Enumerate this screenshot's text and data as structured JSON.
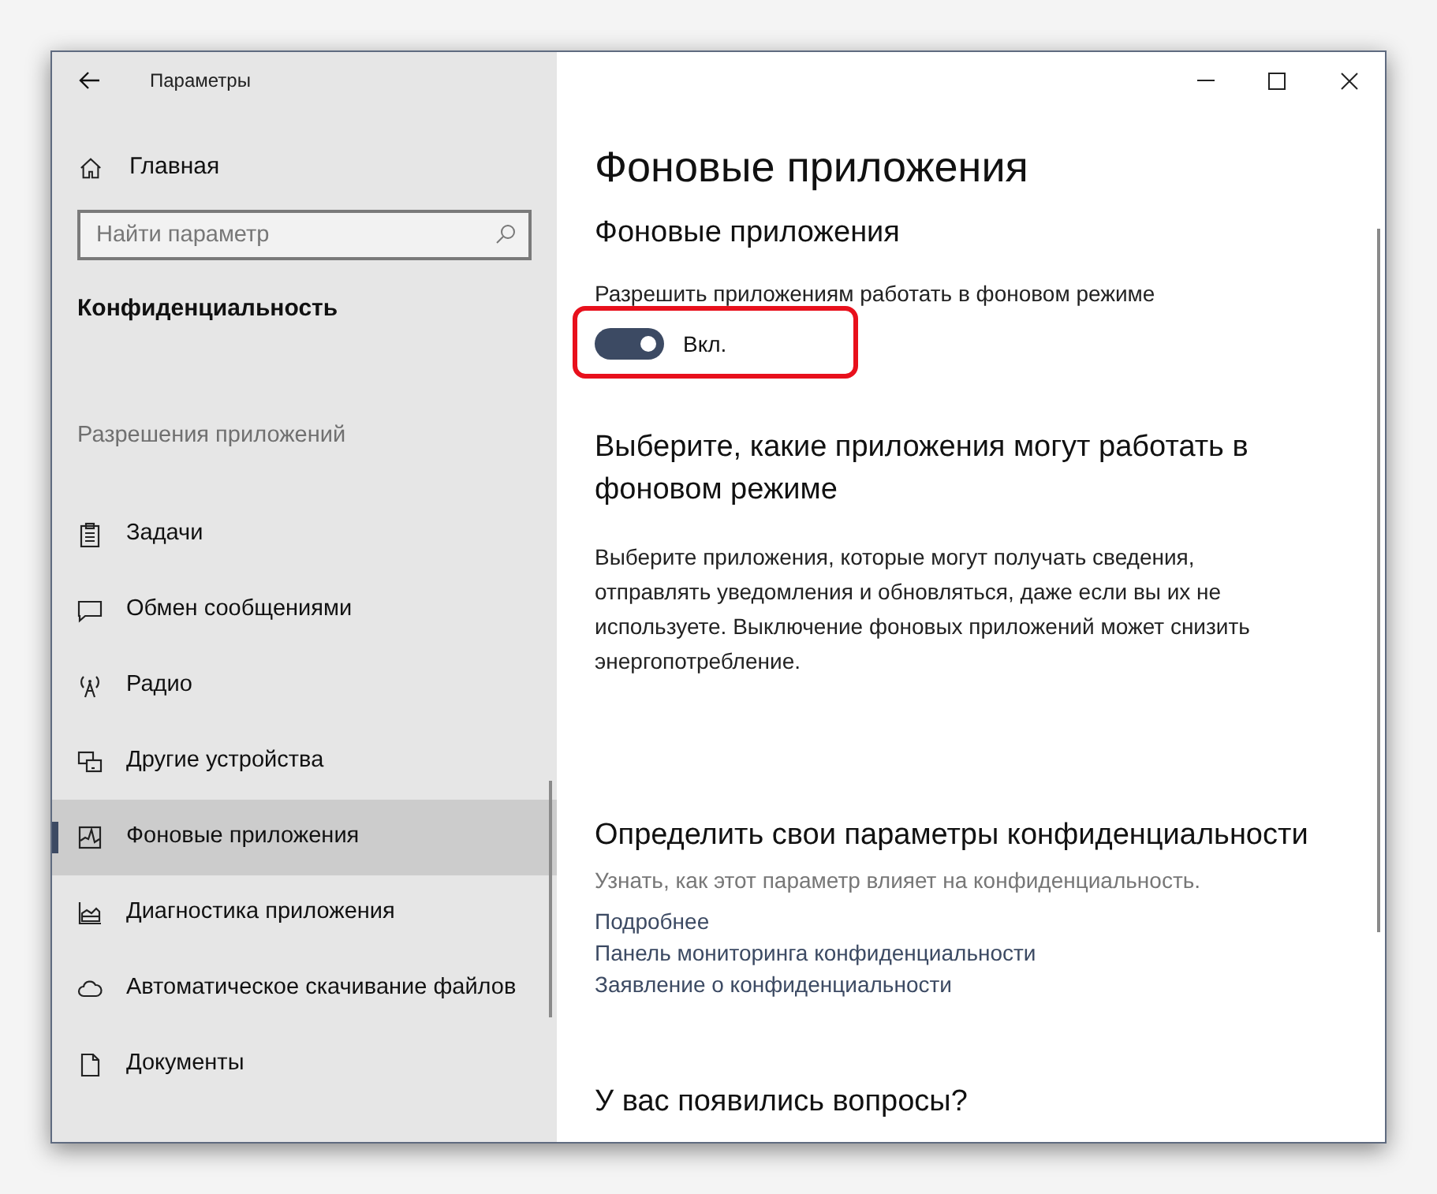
{
  "window": {
    "title": "Параметры"
  },
  "sidebar": {
    "home": "Главная",
    "search": {
      "placeholder": "Найти параметр"
    },
    "section_title": "Конфиденциальность",
    "group_label": "Разрешения приложений",
    "items": [
      {
        "label": "Задачи",
        "selected": false
      },
      {
        "label": "Обмен сообщениями",
        "selected": false
      },
      {
        "label": "Радио",
        "selected": false
      },
      {
        "label": "Другие устройства",
        "selected": false
      },
      {
        "label": "Фоновые приложения",
        "selected": true
      },
      {
        "label": "Диагностика приложения",
        "selected": false
      },
      {
        "label": "Автоматическое скачивание файлов",
        "selected": false
      },
      {
        "label": "Документы",
        "selected": false
      }
    ]
  },
  "content": {
    "title": "Фоновые приложения",
    "background_section": {
      "heading": "Фоновые приложения",
      "label": "Разрешить приложениям работать в фоновом режиме",
      "toggle": {
        "on": true,
        "state_text": "Вкл.",
        "highlighted": true
      }
    },
    "choose_section": {
      "heading": "Выберите, какие приложения могут работать в фоновом режиме",
      "description": "Выберите приложения, которые могут получать сведения, отправлять уведомления и обновляться, даже если вы их не используете. Выключение фоновых приложений может снизить энергопотребление."
    },
    "privacy_section": {
      "heading": "Определить свои параметры конфиденциальности",
      "note": "Узнать, как этот параметр влияет на конфиденциальность.",
      "links": [
        "Подробнее",
        "Панель мониторинга конфиденциальности",
        "Заявление о конфиденциальности"
      ]
    },
    "questions_section": {
      "heading": "У вас появились вопросы?"
    }
  }
}
